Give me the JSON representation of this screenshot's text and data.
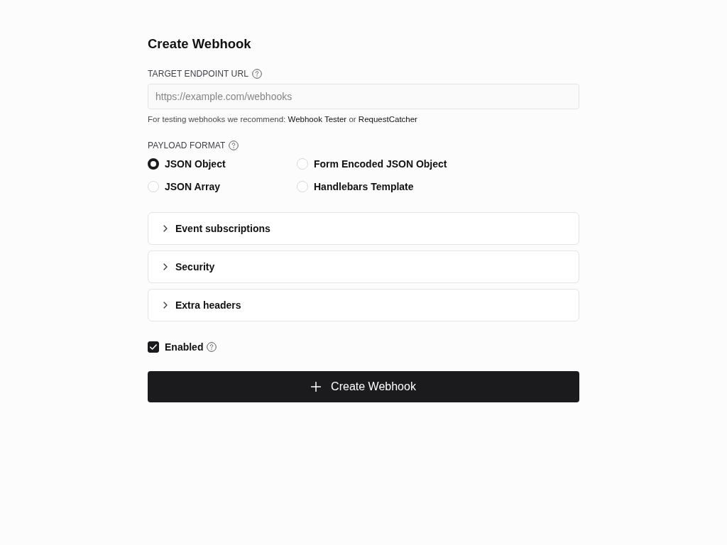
{
  "title": "Create Webhook",
  "endpoint": {
    "label": "TARGET ENDPOINT URL",
    "placeholder": "https://example.com/webhooks",
    "hint": [
      {
        "kind": "text",
        "text": "For testing webhooks we recommend:"
      },
      {
        "kind": "link",
        "text": "Webhook Tester"
      },
      {
        "kind": "text",
        "text": "or"
      },
      {
        "kind": "link",
        "text": "RequestCatcher"
      }
    ]
  },
  "payload_format": {
    "label": "PAYLOAD FORMAT",
    "options": [
      {
        "label": "JSON Object",
        "selected": true
      },
      {
        "label": "Form Encoded JSON Object",
        "selected": false
      },
      {
        "label": "JSON Array",
        "selected": false
      },
      {
        "label": "Handlebars Template",
        "selected": false
      }
    ]
  },
  "sections": [
    {
      "label": "Event subscriptions",
      "expanded": false
    },
    {
      "label": "Security",
      "expanded": false
    },
    {
      "label": "Extra headers",
      "expanded": false
    }
  ],
  "enabled": {
    "label": "Enabled",
    "checked": true
  },
  "submit_button": {
    "label": "Create Webhook"
  }
}
